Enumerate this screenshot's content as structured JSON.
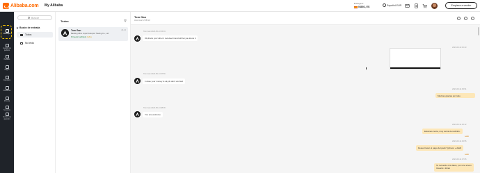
{
  "header": {
    "logo_text": "Alibaba.com",
    "my_alibaba": "My Alibaba",
    "deliver_label": "Entrega a:",
    "deliver_zip": "04801, ES",
    "language": "Español-EUR",
    "sell_button": "Empieza a vender",
    "brand_color": "#ff6a00"
  },
  "rail": {
    "items": [
      {
        "label": "Mensajes",
        "icon": "chat-icon"
      },
      {
        "label": "Gestión de pedidos",
        "icon": "orders-icon"
      },
      {
        "label": "Pedidos",
        "icon": "box-icon"
      },
      {
        "label": "Pagos",
        "icon": "wallet-icon"
      },
      {
        "label": "Favoritos",
        "icon": "heart-icon"
      },
      {
        "label": "Contactos",
        "icon": "contacts-icon"
      },
      {
        "label": "Mi Lista",
        "icon": "list-icon"
      },
      {
        "label": "Servicios",
        "icon": "services-icon"
      },
      {
        "label": "Servicio de atención",
        "icon": "support-icon"
      }
    ]
  },
  "folders": {
    "search_placeholder": "Buscar",
    "inbox_label": "Buzón de entrada",
    "all_label": "Todos",
    "unread_label": "No leído"
  },
  "conversations": {
    "title": "Todos",
    "items": [
      {
        "name": "Tom Gan",
        "date": "22-14",
        "company": "Baoding Aiher Import & Export Trading Co., Ltd.",
        "tag": "Proveedor verificado",
        "tag_extra": "4 años"
      }
    ]
  },
  "chat": {
    "contact_name": "Tom Gan",
    "local_time": "Hora local: 2:58 AM",
    "messages": [
      {
        "dir": "in",
        "meta": "Tom Gan  2023-05-13 15:04",
        "text": "Ok,thank you! when I received it and will let you know it"
      },
      {
        "dir": "in",
        "meta": "Tom Gan  2023-05-14 07:56",
        "text": "it dose your money is ok,pls don't worried"
      },
      {
        "dir": "in",
        "meta": "Tom Gan  2023-05-14 08:09",
        "text": "You are welcome"
      }
    ],
    "out_timestamps": [
      "2023-05-13 15:23",
      "2023-05-14 05:51",
      "2023-05-14 06:12",
      "2023-05-14 06:55",
      "2023-05-14 07:05"
    ],
    "out_messages": [
      "Muchas gracias por todo",
      "Estamos cerca, muy cerca de recibirlo.",
      "Deseo hacer el pago del pack Typhoon + Alaf4",
      "Te recuerdo mis datos, por si te sirven"
    ],
    "out_extra": "Usuario: Johan",
    "read_label": "Leído"
  }
}
